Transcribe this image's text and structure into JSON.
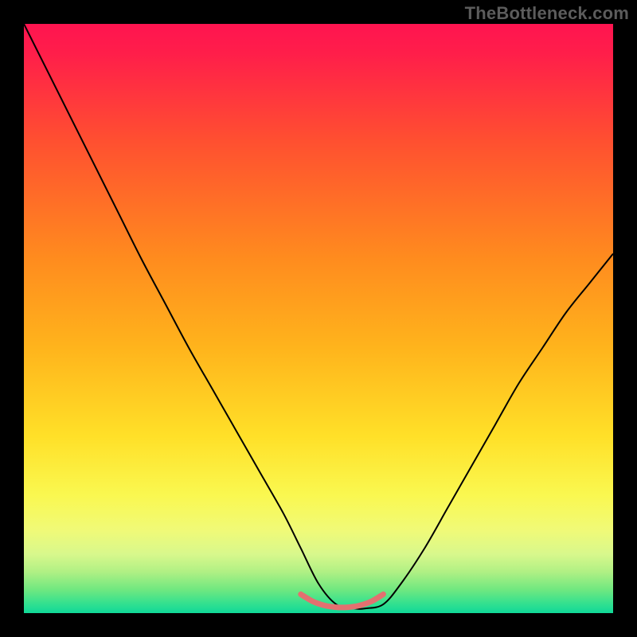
{
  "watermark": "TheBottleneck.com",
  "chart_data": {
    "type": "line",
    "title": "",
    "xlabel": "",
    "ylabel": "",
    "xlim": [
      0,
      100
    ],
    "ylim": [
      0,
      100
    ],
    "background_gradient": {
      "stops": [
        {
          "offset": 0.0,
          "color": "#ff1450"
        },
        {
          "offset": 0.05,
          "color": "#ff1e4a"
        },
        {
          "offset": 0.2,
          "color": "#ff5030"
        },
        {
          "offset": 0.4,
          "color": "#ff8c1e"
        },
        {
          "offset": 0.55,
          "color": "#ffb41c"
        },
        {
          "offset": 0.7,
          "color": "#ffe028"
        },
        {
          "offset": 0.8,
          "color": "#faf850"
        },
        {
          "offset": 0.86,
          "color": "#f0fa78"
        },
        {
          "offset": 0.9,
          "color": "#d8f88c"
        },
        {
          "offset": 0.93,
          "color": "#b0f084"
        },
        {
          "offset": 0.96,
          "color": "#70e880"
        },
        {
          "offset": 0.985,
          "color": "#30e090"
        },
        {
          "offset": 1.0,
          "color": "#10d898"
        }
      ]
    },
    "series": [
      {
        "name": "bottleneck-curve",
        "color": "#000000",
        "width": 2,
        "x": [
          0,
          4,
          8,
          12,
          16,
          20,
          24,
          28,
          32,
          36,
          40,
          44,
          47,
          50,
          53,
          56,
          58,
          61,
          64,
          68,
          72,
          76,
          80,
          84,
          88,
          92,
          96,
          100
        ],
        "y": [
          100,
          92,
          84,
          76,
          68,
          60,
          52.5,
          45,
          38,
          31,
          24,
          17,
          11,
          5,
          1.5,
          0.8,
          0.8,
          1.5,
          5,
          11,
          18,
          25,
          32,
          39,
          45,
          51,
          56,
          61
        ]
      }
    ],
    "bottom_marker": {
      "name": "optimal-range",
      "color": "#e37070",
      "width": 7,
      "x": [
        47,
        49,
        51,
        53,
        55,
        57,
        59,
        61
      ],
      "y": [
        3.2,
        2.0,
        1.3,
        1.0,
        1.0,
        1.3,
        2.0,
        3.2
      ]
    }
  }
}
